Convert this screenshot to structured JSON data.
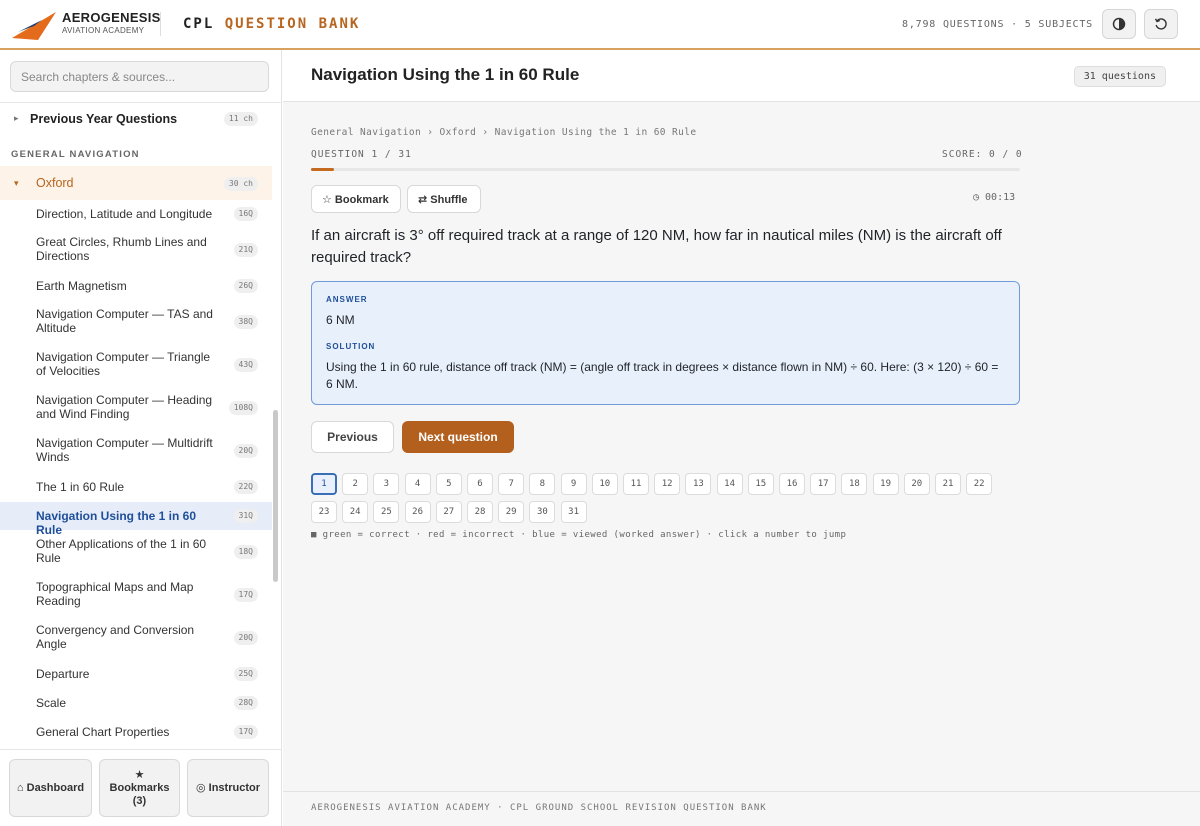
{
  "header": {
    "brand_name": "AEROGENESIS",
    "brand_sub": "AVIATION ACADEMY",
    "title_prefix": "CPL",
    "title_accent": "QUESTION BANK",
    "stats": "8,798 QUESTIONS · 5 SUBJECTS",
    "theme_icon": "contrast-icon",
    "reset_icon": "reset-icon"
  },
  "sidebar": {
    "search_placeholder": "Search chapters & sources...",
    "pyq": {
      "label": "Previous Year Questions",
      "badge": "11 ch"
    },
    "section": "GENERAL NAVIGATION",
    "oxford": {
      "label": "Oxford",
      "badge": "30 ch"
    },
    "chapters": [
      {
        "label": "Direction, Latitude and Longitude",
        "badge": "16Q"
      },
      {
        "label": "Great Circles, Rhumb Lines and Directions",
        "badge": "21Q"
      },
      {
        "label": "Earth Magnetism",
        "badge": "26Q"
      },
      {
        "label": "Navigation Computer — TAS and Altitude",
        "badge": "38Q"
      },
      {
        "label": "Navigation Computer — Triangle of Velocities",
        "badge": "43Q"
      },
      {
        "label": "Navigation Computer — Heading and Wind Finding",
        "badge": "108Q"
      },
      {
        "label": "Navigation Computer — Multidrift Winds",
        "badge": "20Q"
      },
      {
        "label": "The 1 in 60 Rule",
        "badge": "22Q"
      },
      {
        "label": "Navigation Using the 1 in 60 Rule",
        "badge": "31Q"
      },
      {
        "label": "Other Applications of the 1 in 60 Rule",
        "badge": "18Q"
      },
      {
        "label": "Topographical Maps and Map Reading",
        "badge": "17Q"
      },
      {
        "label": "Convergency and Conversion Angle",
        "badge": "20Q"
      },
      {
        "label": "Departure",
        "badge": "25Q"
      },
      {
        "label": "Scale",
        "badge": "28Q"
      },
      {
        "label": "General Chart Properties",
        "badge": "17Q"
      }
    ],
    "buttons": {
      "dashboard": "⌂ Dashboard",
      "bookmarks_icon": "★",
      "bookmarks": "Bookmarks",
      "bookmarks_count": "(3)",
      "instructor": "◎ Instructor"
    }
  },
  "main": {
    "title": "Navigation Using the 1 in 60 Rule",
    "count_badge": "31 questions",
    "breadcrumb": "General Navigation › Oxford › Navigation Using the 1 in 60 Rule",
    "question_label": "QUESTION 1 / 31",
    "score": "SCORE: 0 / 0",
    "progress": 0.0323,
    "bookmark_label": "☆ Bookmark",
    "shuffle_label": "⇄ Shuffle",
    "timer": "◷ 00:13",
    "question": "If an aircraft is 3° off required track at a range of 120 NM, how far in nautical miles (NM) is the aircraft off required track?",
    "answer_heading": "ANSWER",
    "answer": "6 NM",
    "solution_heading": "SOLUTION",
    "solution": "Using the 1 in 60 rule, distance off track (NM) = (angle off track in degrees × distance flown in NM) ÷ 60. Here: (3 × 120) ÷ 60 = 6 NM.",
    "prev_label": "Previous",
    "next_label": "Next question",
    "numbers": [
      "1",
      "2",
      "3",
      "4",
      "5",
      "6",
      "7",
      "8",
      "9",
      "10",
      "11",
      "12",
      "13",
      "14",
      "15",
      "16",
      "17",
      "18",
      "19",
      "20",
      "21",
      "22",
      "23",
      "24",
      "25",
      "26",
      "27",
      "28",
      "29",
      "30",
      "31"
    ],
    "legend": "■ green = correct · red = incorrect · blue = viewed (worked answer) · click a number to jump",
    "footer": "AEROGENESIS AVIATION ACADEMY · CPL GROUND SCHOOL REVISION QUESTION BANK"
  },
  "colors": {
    "accent": "#b35f1d",
    "active_blue": "#1f4f9a",
    "answer_bg": "#e8f0fb"
  }
}
